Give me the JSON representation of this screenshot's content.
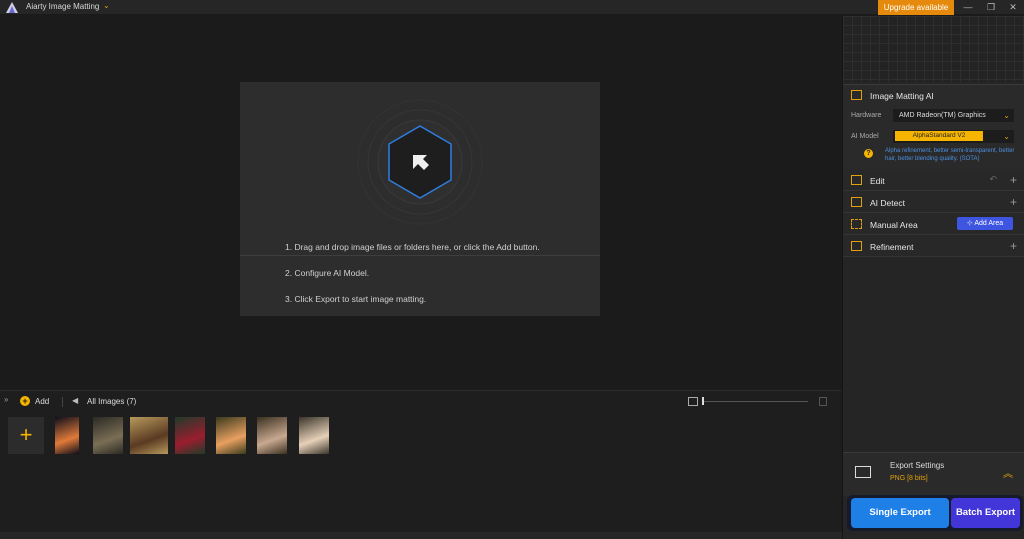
{
  "titlebar": {
    "app_name": "Aiarty Image Matting",
    "upgrade_label": "Upgrade available",
    "minimize": "—",
    "maximize": "❐",
    "close": "✕"
  },
  "drop_area": {
    "steps": [
      "1. Drag and drop image files or folders here, or click the Add button.",
      "2. Configure AI Model.",
      "3. Click Export to start image matting."
    ]
  },
  "image_strip": {
    "add_label": "Add",
    "all_images_label": "All Images (7)",
    "thumbnails": [
      {
        "name": "jellyfish",
        "colors": [
          "#0d0d1a",
          "#e07a3a"
        ]
      },
      {
        "name": "dragon",
        "colors": [
          "#2b2a24",
          "#7a6e55"
        ]
      },
      {
        "name": "bicycle",
        "colors": [
          "#b89a5c",
          "#5a3a22"
        ]
      },
      {
        "name": "woman-red-dress",
        "colors": [
          "#1f3b2a",
          "#9a1e2e"
        ]
      },
      {
        "name": "woman-flowers-1",
        "colors": [
          "#3a3a1e",
          "#e8a060"
        ]
      },
      {
        "name": "woman-flowers-2",
        "colors": [
          "#3b3020",
          "#c8a890"
        ]
      },
      {
        "name": "woman-flowers-3",
        "colors": [
          "#3a352a",
          "#e6d0b8"
        ]
      }
    ]
  },
  "right_panel": {
    "ai_section": {
      "title": "Image Matting AI",
      "hardware_label": "Hardware",
      "hardware_value": "AMD Radeon(TM) Graphics",
      "model_label": "AI Model",
      "model_value": "AlphaStandard  V2",
      "model_description": "Alpha refinement, better semi-transparent, better hair, better blending quality. (SOTA)"
    },
    "sections": {
      "edit": "Edit",
      "ai_detect": "AI Detect",
      "manual_area": "Manual Area",
      "add_area": "Add Area",
      "refinement": "Refinement"
    },
    "export": {
      "settings_title": "Export Settings",
      "format": "PNG   [8 bits]",
      "single_label": "Single Export",
      "batch_label": "Batch Export"
    }
  },
  "colors": {
    "accent": "#f4b400",
    "single_export": "#1e7fe6",
    "batch_export": "#4336d9",
    "upgrade": "#e58a0c"
  }
}
